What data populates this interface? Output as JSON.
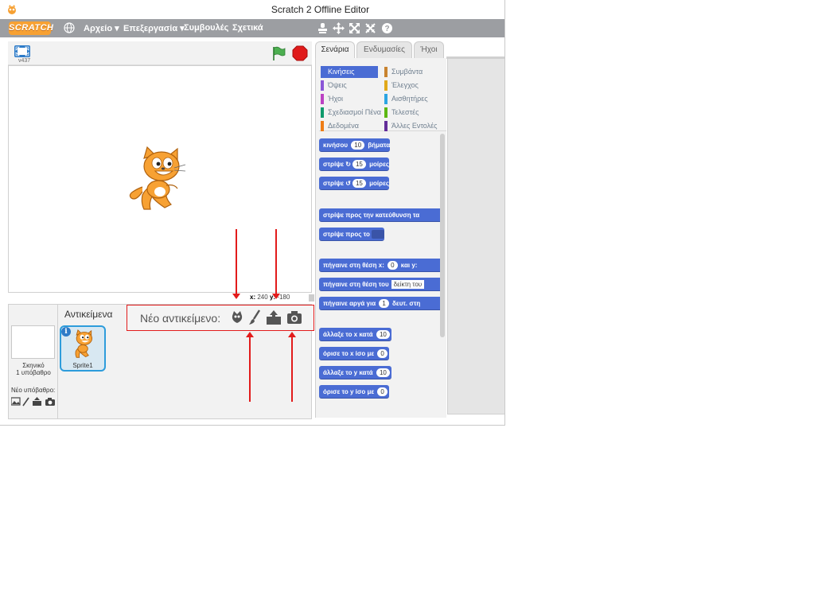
{
  "window": {
    "title": "Scratch 2 Offline Editor"
  },
  "menubar": {
    "logo": "SCRATCH",
    "items": [
      "Αρχείο ▾",
      "Επεξεργασία ▾",
      "Συμβουλές",
      "Σχετικά"
    ],
    "tools": [
      "stamp-icon",
      "grow-icon",
      "expand-icon",
      "shrink-icon",
      "help-icon"
    ]
  },
  "stage": {
    "version": "v437",
    "coords": {
      "x_label": "x:",
      "x": "240",
      "y_label": "y:",
      "y": "-180"
    }
  },
  "sprites": {
    "title": "Αντικείμενα",
    "stage_name": "Σκηνικό",
    "stage_sub": "1 υπόβαθρο",
    "new_backdrop_label": "Νέο υπόβαθρο:",
    "items": [
      {
        "name": "Sprite1"
      }
    ]
  },
  "new_sprite": {
    "label": "Νέο αντικείμενο:"
  },
  "tabs": [
    "Σενάρια",
    "Ενδυμασίες",
    "Ήχοι"
  ],
  "categories": [
    {
      "label": "Κινήσεις",
      "color": "#4a6cd4",
      "selected": true
    },
    {
      "label": "Συμβάντα",
      "color": "#c88330"
    },
    {
      "label": "Όψεις",
      "color": "#8a55d7"
    },
    {
      "label": "Έλεγχος",
      "color": "#e1a91a"
    },
    {
      "label": "Ήχοι",
      "color": "#bb42c3"
    },
    {
      "label": "Αισθητήρες",
      "color": "#2ca5e2"
    },
    {
      "label": "Σχεδιασμοί Πένα",
      "color": "#0e9a6c"
    },
    {
      "label": "Τελεστές",
      "color": "#5cb712"
    },
    {
      "label": "Δεδομένα",
      "color": "#ee7d16"
    },
    {
      "label": "Άλλες Εντολές",
      "color": "#632d99"
    }
  ],
  "blocks": {
    "move": {
      "pre": "κινήσου",
      "num": "10",
      "post": "βήματα"
    },
    "turn_right": {
      "pre": "στρίψε",
      "num": "15",
      "post": "μοίρες"
    },
    "turn_left": {
      "pre": "στρίψε",
      "num": "15",
      "post": "μοίρες"
    },
    "point_dir": {
      "text": "στρίψε προς την κατεύθυνση τα"
    },
    "point_towards": {
      "text": "στρίψε προς το"
    },
    "goto_xy": {
      "pre": "πήγαινε στη θέση x:",
      "num": "0",
      "mid": "και y:"
    },
    "goto": {
      "pre": "πήγαινε στη θέση του",
      "str": "δείκτη του"
    },
    "glide": {
      "pre": "πήγαινε αργά για",
      "num": "1",
      "post": "δευτ. στη"
    },
    "change_x": {
      "pre": "άλλαξε το x κατά",
      "num": "10"
    },
    "set_x": {
      "pre": "όρισε το x ίσο με",
      "num": "0"
    },
    "change_y": {
      "pre": "άλλαξε το y κατά",
      "num": "10"
    },
    "set_y": {
      "pre": "όρισε το y ίσο με",
      "num": "0"
    }
  },
  "colors": {
    "menubar": "#9c9ea2",
    "motion": "#4a6cd4",
    "annotation": "#e21b1b",
    "selection": "#2d9cdb"
  }
}
